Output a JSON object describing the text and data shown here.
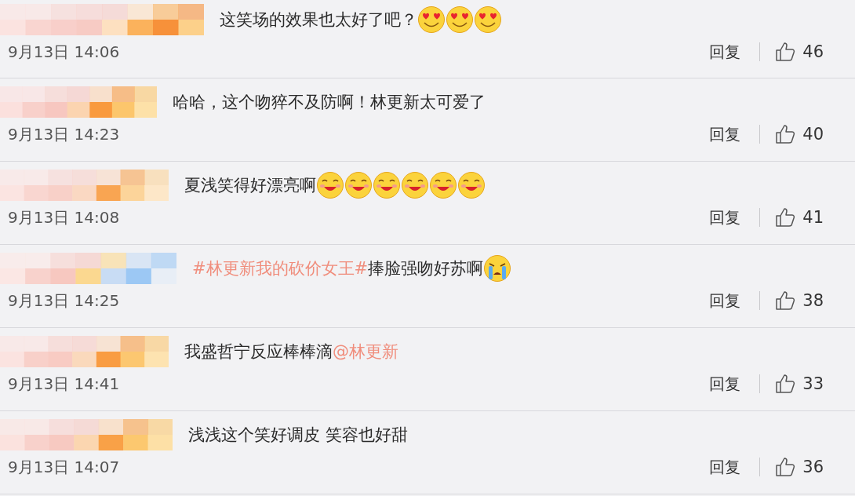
{
  "comments": [
    {
      "content": [
        {
          "kind": "text",
          "text": "这笑场的效果也太好了吧？"
        },
        {
          "kind": "loveface"
        },
        {
          "kind": "loveface"
        },
        {
          "kind": "loveface"
        }
      ],
      "time": "9月13日 14:06",
      "reply": "回复",
      "likes": "46"
    },
    {
      "content": [
        {
          "kind": "text",
          "text": "哈哈，这个吻猝不及防啊！林更新太可爱了"
        }
      ],
      "time": "9月13日 14:23",
      "reply": "回复",
      "likes": "40"
    },
    {
      "content": [
        {
          "kind": "text",
          "text": "夏浅笑得好漂亮啊"
        },
        {
          "kind": "blushface"
        },
        {
          "kind": "blushface"
        },
        {
          "kind": "blushface"
        },
        {
          "kind": "blushface"
        },
        {
          "kind": "blushface"
        },
        {
          "kind": "blushface"
        }
      ],
      "time": "9月13日 14:08",
      "reply": "回复",
      "likes": "41"
    },
    {
      "content": [
        {
          "kind": "hashtag",
          "text": "#林更新我的砍价女王#"
        },
        {
          "kind": "text",
          "text": " 捧脸强吻好苏啊"
        },
        {
          "kind": "cryface"
        }
      ],
      "time": "9月13日 14:25",
      "reply": "回复",
      "likes": "38"
    },
    {
      "content": [
        {
          "kind": "text",
          "text": "我盛哲宁反应棒棒滴"
        },
        {
          "kind": "mention",
          "text": "@林更新"
        }
      ],
      "time": "9月13日 14:41",
      "reply": "回复",
      "likes": "33"
    },
    {
      "content": [
        {
          "kind": "text",
          "text": "浅浅这个笑好调皮 笑容也好甜"
        }
      ],
      "time": "9月13日 14:07",
      "reply": "回复",
      "likes": "36"
    }
  ]
}
